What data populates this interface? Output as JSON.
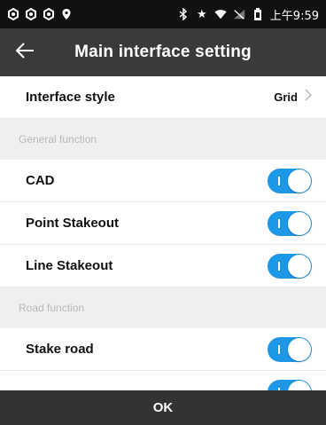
{
  "status_bar": {
    "left_icons": [
      "notification-icon",
      "notification-icon",
      "notification-icon",
      "location-pin-icon"
    ],
    "right_icons": [
      "bluetooth-icon",
      "star-icon",
      "wifi-icon",
      "signal-icon",
      "battery-icon"
    ],
    "time": "上午9:59"
  },
  "header": {
    "back_icon": "arrow-left-icon",
    "title": "Main interface setting"
  },
  "settings": {
    "interface_style": {
      "label": "Interface style",
      "value": "Grid"
    },
    "general_function": {
      "header": "General function",
      "items": [
        {
          "label": "CAD",
          "enabled": true
        },
        {
          "label": "Point Stakeout",
          "enabled": true
        },
        {
          "label": "Line Stakeout",
          "enabled": true
        }
      ]
    },
    "road_function": {
      "header": "Road function",
      "items": [
        {
          "label": "Stake road",
          "enabled": true
        },
        {
          "label": "",
          "enabled": true
        }
      ]
    }
  },
  "footer": {
    "ok_label": "OK"
  },
  "colors": {
    "status_bar": "#111111",
    "title_bar": "#3a3a3a",
    "toggle_on": "#1e97e6",
    "section_bg": "#efefef",
    "footer_bg": "#333333"
  }
}
